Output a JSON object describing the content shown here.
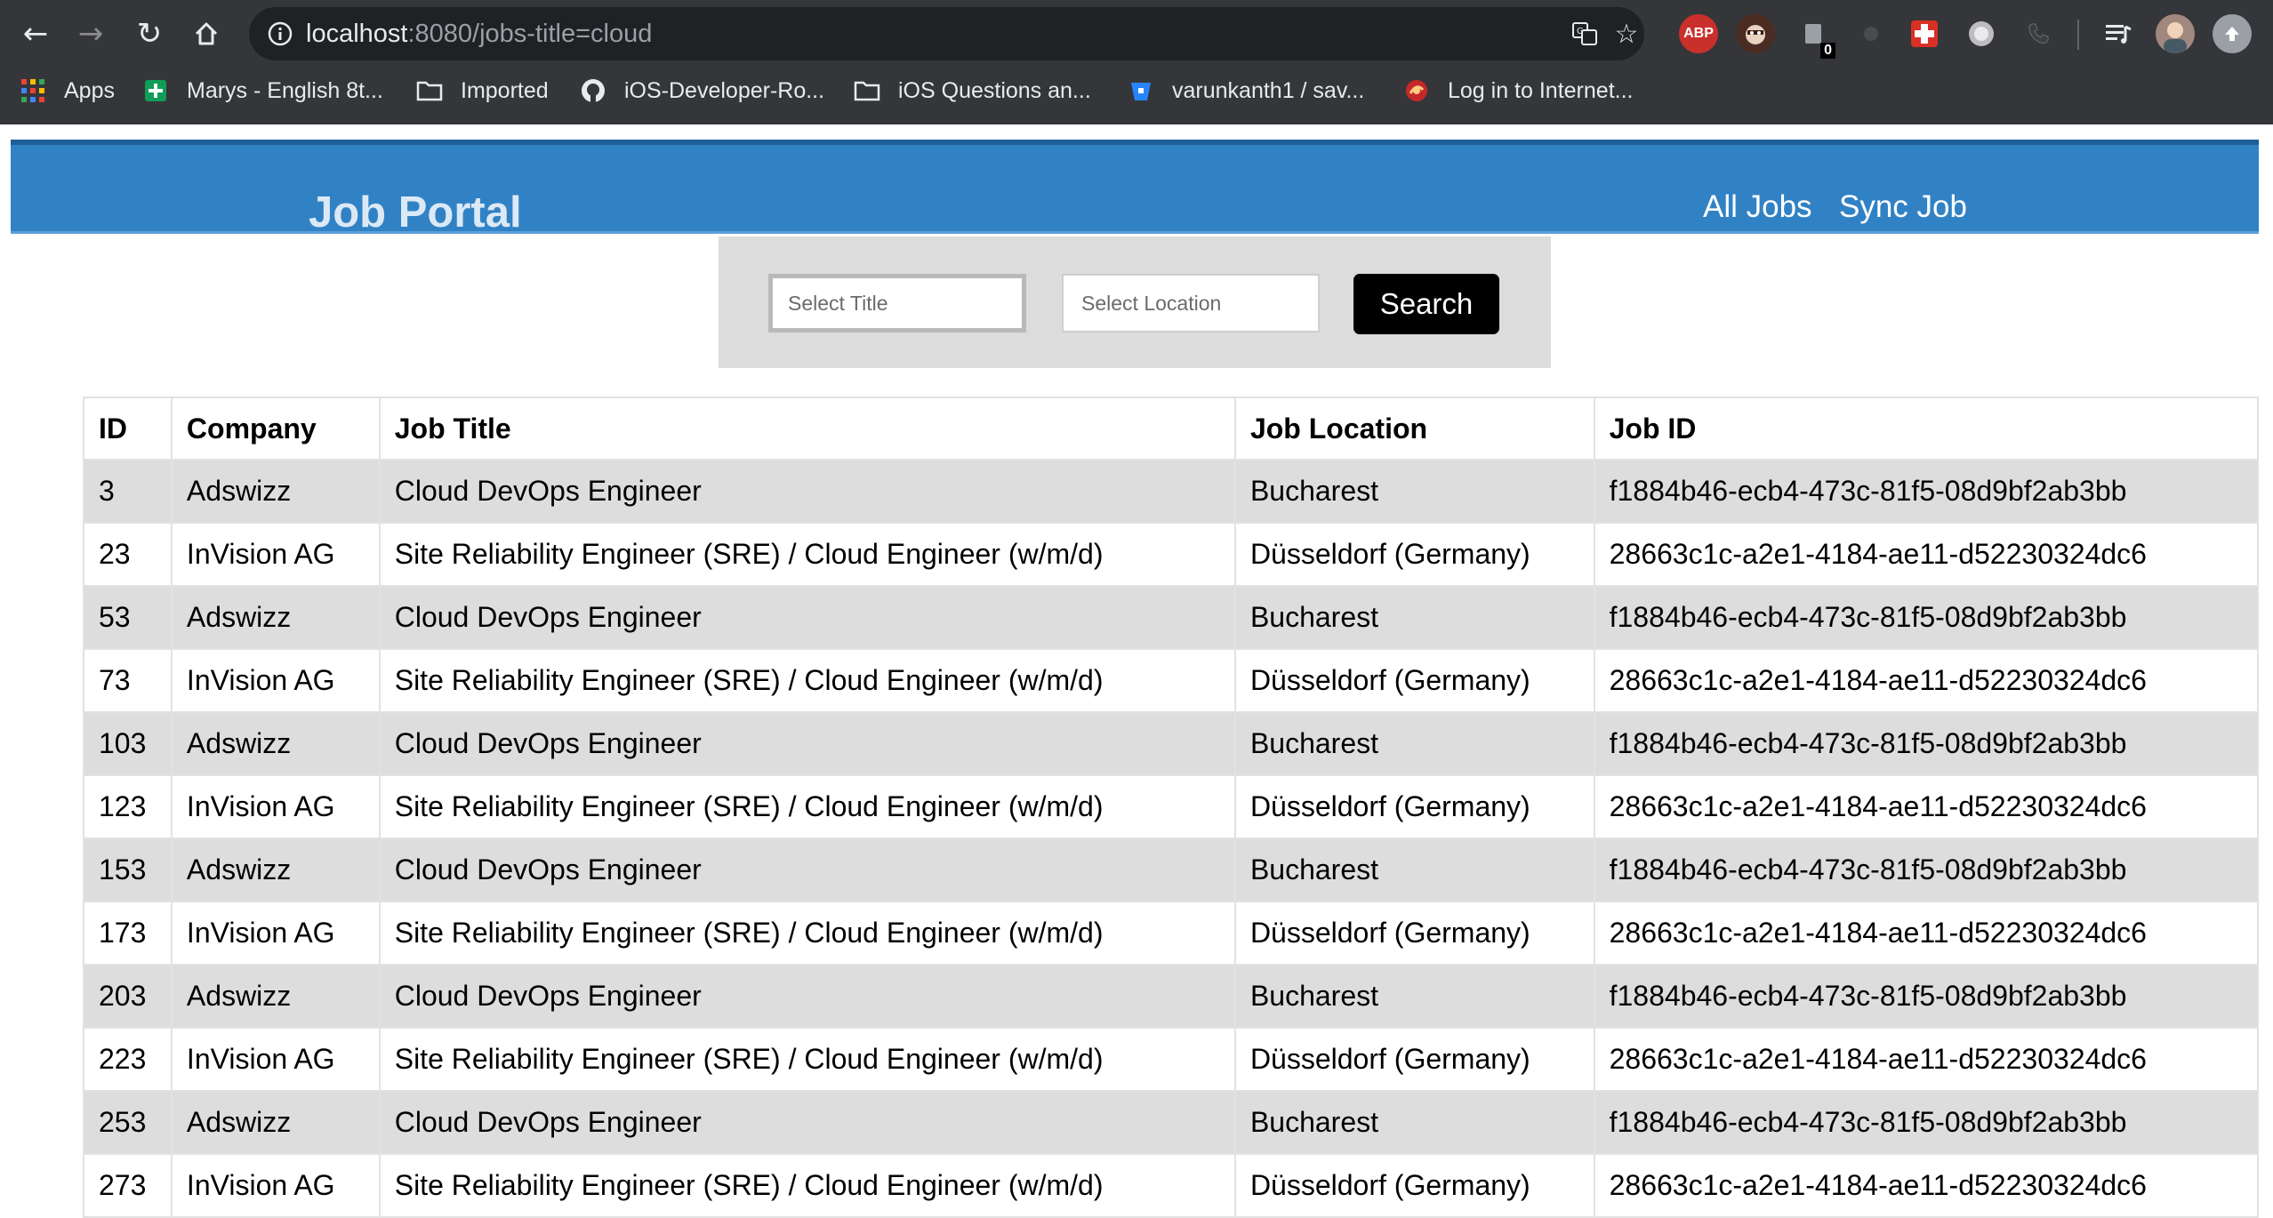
{
  "browser": {
    "url_host": "localhost",
    "url_rest": ":8080/jobs-title=cloud",
    "extensions": {
      "abp_label": "ABP",
      "badge_count": "0"
    },
    "bookmarks": [
      {
        "label": "Apps",
        "icon": "apps-grid-icon"
      },
      {
        "label": "Marys - English 8t...",
        "icon": "sheets-plus-icon"
      },
      {
        "label": "Imported",
        "icon": "folder-icon"
      },
      {
        "label": "iOS-Developer-Ro...",
        "icon": "github-icon"
      },
      {
        "label": "iOS Questions an...",
        "icon": "folder-icon"
      },
      {
        "label": "varunkanth1 / sav...",
        "icon": "bitbucket-icon"
      },
      {
        "label": "Log in to Internet...",
        "icon": "login-icon"
      }
    ]
  },
  "app": {
    "brand": "Job Portal",
    "nav": {
      "all_jobs": "All Jobs",
      "sync_job": "Sync Job"
    },
    "search": {
      "title_placeholder": "Select Title",
      "location_placeholder": "Select Location",
      "button_label": "Search"
    },
    "colors": {
      "header_bg": "#3182c5",
      "row_stripe": "#dddddd",
      "button_bg": "#000000"
    }
  },
  "table": {
    "headers": {
      "id": "ID",
      "company": "Company",
      "job_title": "Job Title",
      "job_location": "Job Location",
      "job_id": "Job ID"
    },
    "rows": [
      {
        "id": "3",
        "company": "Adswizz",
        "title": "Cloud DevOps Engineer",
        "location": "Bucharest",
        "job_id": "f1884b46-ecb4-473c-81f5-08d9bf2ab3bb"
      },
      {
        "id": "23",
        "company": "InVision AG",
        "title": "Site Reliability Engineer (SRE) / Cloud Engineer (w/m/d)",
        "location": "Düsseldorf (Germany)",
        "job_id": "28663c1c-a2e1-4184-ae11-d52230324dc6"
      },
      {
        "id": "53",
        "company": "Adswizz",
        "title": "Cloud DevOps Engineer",
        "location": "Bucharest",
        "job_id": "f1884b46-ecb4-473c-81f5-08d9bf2ab3bb"
      },
      {
        "id": "73",
        "company": "InVision AG",
        "title": "Site Reliability Engineer (SRE) / Cloud Engineer (w/m/d)",
        "location": "Düsseldorf (Germany)",
        "job_id": "28663c1c-a2e1-4184-ae11-d52230324dc6"
      },
      {
        "id": "103",
        "company": "Adswizz",
        "title": "Cloud DevOps Engineer",
        "location": "Bucharest",
        "job_id": "f1884b46-ecb4-473c-81f5-08d9bf2ab3bb"
      },
      {
        "id": "123",
        "company": "InVision AG",
        "title": "Site Reliability Engineer (SRE) / Cloud Engineer (w/m/d)",
        "location": "Düsseldorf (Germany)",
        "job_id": "28663c1c-a2e1-4184-ae11-d52230324dc6"
      },
      {
        "id": "153",
        "company": "Adswizz",
        "title": "Cloud DevOps Engineer",
        "location": "Bucharest",
        "job_id": "f1884b46-ecb4-473c-81f5-08d9bf2ab3bb"
      },
      {
        "id": "173",
        "company": "InVision AG",
        "title": "Site Reliability Engineer (SRE) / Cloud Engineer (w/m/d)",
        "location": "Düsseldorf (Germany)",
        "job_id": "28663c1c-a2e1-4184-ae11-d52230324dc6"
      },
      {
        "id": "203",
        "company": "Adswizz",
        "title": "Cloud DevOps Engineer",
        "location": "Bucharest",
        "job_id": "f1884b46-ecb4-473c-81f5-08d9bf2ab3bb"
      },
      {
        "id": "223",
        "company": "InVision AG",
        "title": "Site Reliability Engineer (SRE) / Cloud Engineer (w/m/d)",
        "location": "Düsseldorf (Germany)",
        "job_id": "28663c1c-a2e1-4184-ae11-d52230324dc6"
      },
      {
        "id": "253",
        "company": "Adswizz",
        "title": "Cloud DevOps Engineer",
        "location": "Bucharest",
        "job_id": "f1884b46-ecb4-473c-81f5-08d9bf2ab3bb"
      },
      {
        "id": "273",
        "company": "InVision AG",
        "title": "Site Reliability Engineer (SRE) / Cloud Engineer (w/m/d)",
        "location": "Düsseldorf (Germany)",
        "job_id": "28663c1c-a2e1-4184-ae11-d52230324dc6"
      }
    ]
  }
}
